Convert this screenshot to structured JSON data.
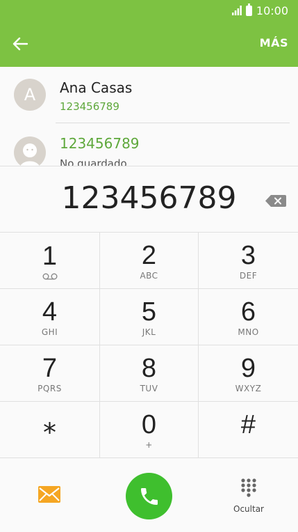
{
  "status": {
    "time": "10:00"
  },
  "appbar": {
    "more_label": "MÁS"
  },
  "contacts": [
    {
      "initial": "A",
      "name": "Ana Casas",
      "number": "123456789"
    },
    {
      "number": "123456789",
      "subtitle": "No guardado"
    }
  ],
  "dialer": {
    "number": "123456789",
    "keys": [
      {
        "digit": "1",
        "letters": ""
      },
      {
        "digit": "2",
        "letters": "ABC"
      },
      {
        "digit": "3",
        "letters": "DEF"
      },
      {
        "digit": "4",
        "letters": "GHI"
      },
      {
        "digit": "5",
        "letters": "JKL"
      },
      {
        "digit": "6",
        "letters": "MNO"
      },
      {
        "digit": "7",
        "letters": "PQRS"
      },
      {
        "digit": "8",
        "letters": "TUV"
      },
      {
        "digit": "9",
        "letters": "WXYZ"
      },
      {
        "digit": "⁎",
        "letters": ""
      },
      {
        "digit": "0",
        "letters": "+"
      },
      {
        "digit": "#",
        "letters": ""
      }
    ]
  },
  "bottom": {
    "hide_label": "Ocultar"
  },
  "colors": {
    "accent": "#7dc242",
    "call": "#3fbf2e",
    "message": "#f5a623",
    "link_green": "#5ea83b"
  }
}
